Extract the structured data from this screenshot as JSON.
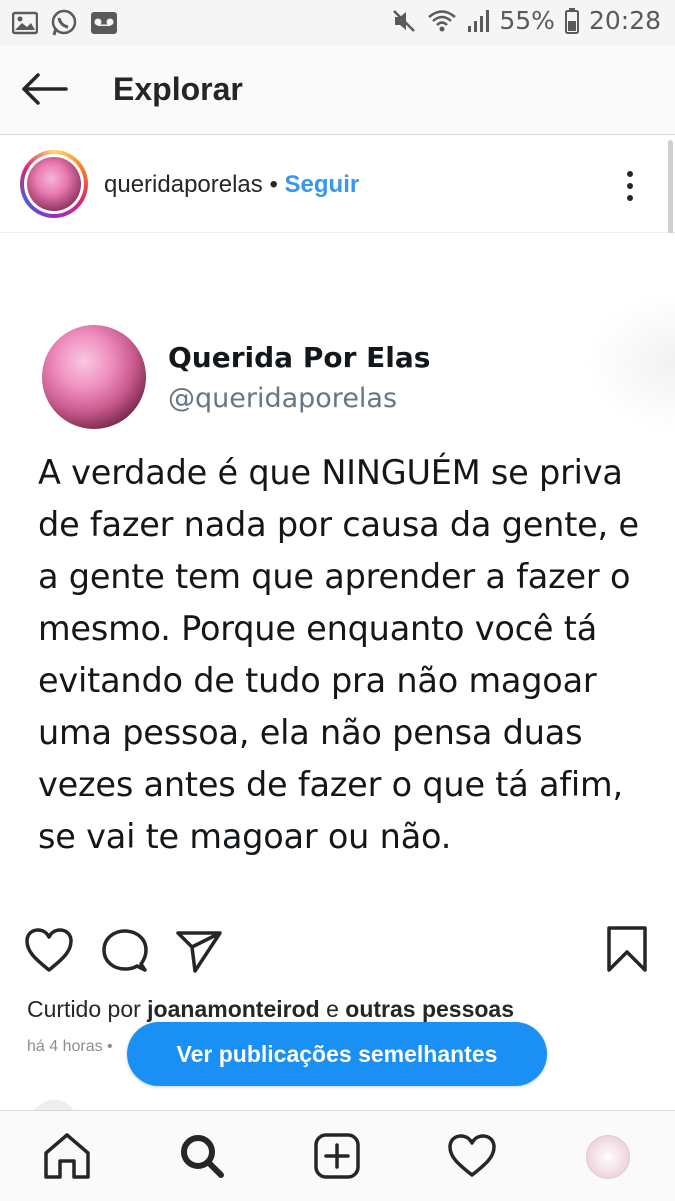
{
  "status_bar": {
    "battery_percent": "55%",
    "time": "20:28",
    "icons": [
      "image-icon",
      "whatsapp-icon",
      "voicemail-icon",
      "mute-icon",
      "wifi-icon",
      "signal-icon",
      "battery-icon"
    ]
  },
  "header": {
    "title": "Explorar",
    "back_icon": "back-arrow-icon"
  },
  "post": {
    "username": "queridaporelas",
    "separator": "•",
    "follow_label": "Seguir",
    "more_icon": "more-vertical-icon"
  },
  "tweet": {
    "name": "Querida Por Elas",
    "handle": "@queridaporelas",
    "text": "A verdade é que NINGUÉM se priva de fazer nada por causa da gente, e a gente tem que aprender a fazer o mesmo. Porque enquanto você tá evitando de tudo pra não magoar uma pessoa, ela não pensa duas vezes antes de fazer o que tá afim, se vai te magoar ou não."
  },
  "likes": {
    "prefix": "Curtido por",
    "user": "joanamonteirod",
    "joiner": "e",
    "others": "outras pessoas"
  },
  "time_ago": "há 4 horas •",
  "similar_button": "Ver publicações semelhantes",
  "comment_peek": "",
  "bottom_nav": [
    "home-icon",
    "search-icon",
    "add-icon",
    "heart-icon",
    "profile-icon"
  ],
  "colors": {
    "link_blue": "#3897f0",
    "pill_blue": "#1a90f5",
    "text": "#262626"
  }
}
